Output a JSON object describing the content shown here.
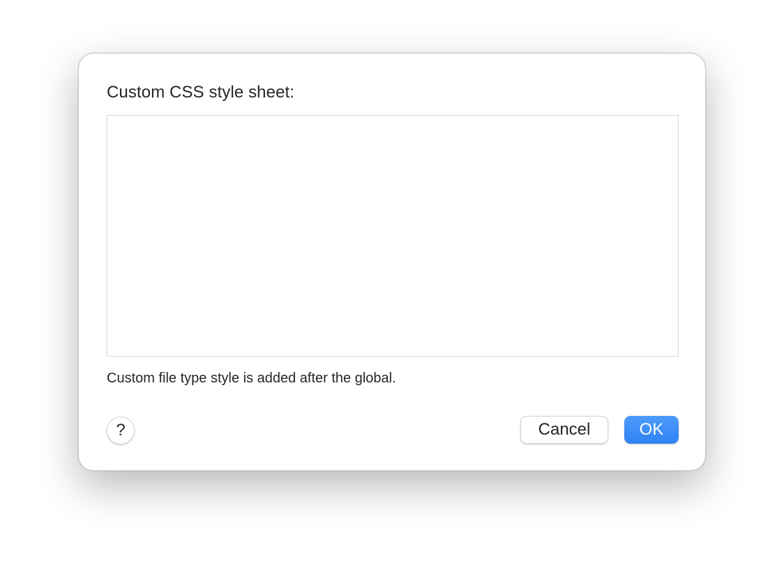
{
  "dialog": {
    "title": "Custom CSS style sheet:",
    "css_value": "",
    "note": "Custom file type style is added after the global.",
    "help_label": "?",
    "cancel_label": "Cancel",
    "ok_label": "OK"
  },
  "colors": {
    "accent": "#3186f6",
    "text": "#262626",
    "border": "#d9d9d9"
  },
  "icons": {
    "help": "question-mark-icon"
  }
}
